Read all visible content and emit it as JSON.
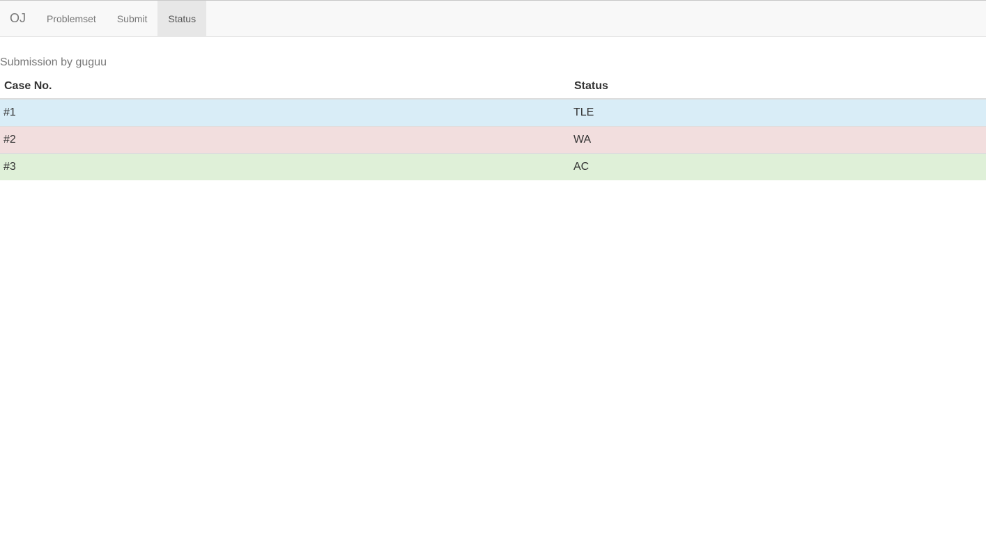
{
  "navbar": {
    "brand": "OJ",
    "items": [
      {
        "label": "Problemset",
        "active": false
      },
      {
        "label": "Submit",
        "active": false
      },
      {
        "label": "Status",
        "active": true
      }
    ]
  },
  "page": {
    "subtitle": "Submission by guguu"
  },
  "table": {
    "headers": [
      "Case No.",
      "Status"
    ],
    "rows": [
      {
        "case": "#1",
        "status": "TLE",
        "row_color": "#d9edf7"
      },
      {
        "case": "#2",
        "status": "WA",
        "row_color": "#f2dede"
      },
      {
        "case": "#3",
        "status": "AC",
        "row_color": "#dff0d8"
      }
    ]
  }
}
